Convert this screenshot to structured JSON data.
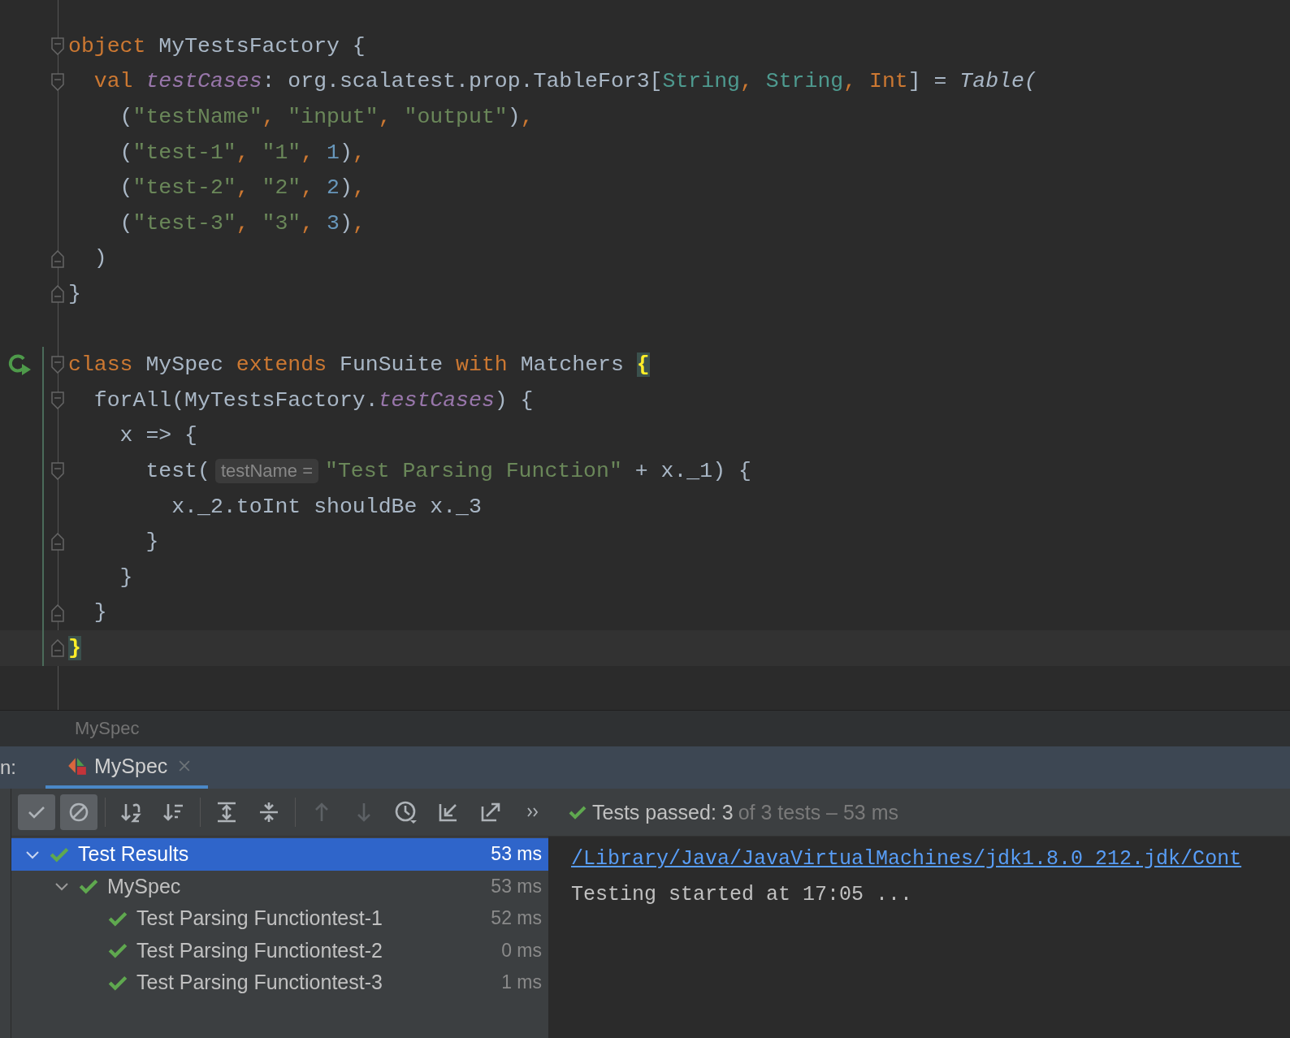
{
  "editor": {
    "lines": [
      {
        "kind": "code",
        "fold_start": true,
        "tokens": [
          {
            "kind": "kw",
            "text": "object"
          },
          {
            "kind": "plain",
            "text": " MyTestsFactory {"
          }
        ]
      },
      {
        "kind": "code",
        "fold_start": true,
        "tokens": [
          {
            "kind": "kw",
            "text": "  val "
          },
          {
            "kind": "field",
            "text": "testCases"
          },
          {
            "kind": "plain",
            "text": ": org.scalatest.prop.TableFor3["
          },
          {
            "kind": "type",
            "text": "String"
          },
          {
            "kind": "kw",
            "text": ", "
          },
          {
            "kind": "type",
            "text": "String"
          },
          {
            "kind": "kw",
            "text": ", "
          },
          {
            "kind": "kw",
            "text": "Int"
          },
          {
            "kind": "plain",
            "text": "] = "
          },
          {
            "kind": "italic",
            "text": "Table("
          }
        ]
      },
      {
        "kind": "code",
        "tokens": [
          {
            "kind": "plain",
            "text": "    ("
          },
          {
            "kind": "str",
            "text": "\"testName\""
          },
          {
            "kind": "kw",
            "text": ", "
          },
          {
            "kind": "str",
            "text": "\"input\""
          },
          {
            "kind": "kw",
            "text": ", "
          },
          {
            "kind": "str",
            "text": "\"output\""
          },
          {
            "kind": "plain",
            "text": ")"
          },
          {
            "kind": "kw",
            "text": ","
          }
        ]
      },
      {
        "kind": "code",
        "tokens": [
          {
            "kind": "plain",
            "text": "    ("
          },
          {
            "kind": "str",
            "text": "\"test-1\""
          },
          {
            "kind": "kw",
            "text": ", "
          },
          {
            "kind": "str",
            "text": "\"1\""
          },
          {
            "kind": "kw",
            "text": ", "
          },
          {
            "kind": "num",
            "text": "1"
          },
          {
            "kind": "plain",
            "text": ")"
          },
          {
            "kind": "kw",
            "text": ","
          }
        ]
      },
      {
        "kind": "code",
        "tokens": [
          {
            "kind": "plain",
            "text": "    ("
          },
          {
            "kind": "str",
            "text": "\"test-2\""
          },
          {
            "kind": "kw",
            "text": ", "
          },
          {
            "kind": "str",
            "text": "\"2\""
          },
          {
            "kind": "kw",
            "text": ", "
          },
          {
            "kind": "num",
            "text": "2"
          },
          {
            "kind": "plain",
            "text": ")"
          },
          {
            "kind": "kw",
            "text": ","
          }
        ]
      },
      {
        "kind": "code",
        "tokens": [
          {
            "kind": "plain",
            "text": "    ("
          },
          {
            "kind": "str",
            "text": "\"test-3\""
          },
          {
            "kind": "kw",
            "text": ", "
          },
          {
            "kind": "str",
            "text": "\"3\""
          },
          {
            "kind": "kw",
            "text": ", "
          },
          {
            "kind": "num",
            "text": "3"
          },
          {
            "kind": "plain",
            "text": ")"
          },
          {
            "kind": "kw",
            "text": ","
          }
        ]
      },
      {
        "kind": "code",
        "fold_end": true,
        "tokens": [
          {
            "kind": "plain",
            "text": "  )"
          }
        ]
      },
      {
        "kind": "code",
        "fold_end": true,
        "tokens": [
          {
            "kind": "plain",
            "text": "}"
          }
        ]
      },
      {
        "kind": "blank"
      },
      {
        "kind": "code",
        "fold_start": true,
        "run": true,
        "changed": true,
        "tokens": [
          {
            "kind": "kw",
            "text": "class"
          },
          {
            "kind": "plain",
            "text": " MySpec "
          },
          {
            "kind": "kw",
            "text": "extends"
          },
          {
            "kind": "plain",
            "text": " FunSuite "
          },
          {
            "kind": "kw",
            "text": "with"
          },
          {
            "kind": "plain",
            "text": " Matchers "
          },
          {
            "kind": "brace",
            "text": "{"
          }
        ]
      },
      {
        "kind": "code",
        "fold_start": true,
        "changed": true,
        "tokens": [
          {
            "kind": "plain",
            "text": "  forAll(MyTestsFactory."
          },
          {
            "kind": "field",
            "text": "testCases"
          },
          {
            "kind": "plain",
            "text": ") {"
          }
        ]
      },
      {
        "kind": "code",
        "changed": true,
        "tokens": [
          {
            "kind": "plain",
            "text": "    x => {"
          }
        ]
      },
      {
        "kind": "code",
        "fold_start": true,
        "changed": true,
        "tokens": [
          {
            "kind": "plain",
            "text": "      test("
          },
          {
            "kind": "hint",
            "text": "testName ="
          },
          {
            "kind": "str",
            "text": "\"Test Parsing Function\""
          },
          {
            "kind": "plain",
            "text": " + x._1) {"
          }
        ]
      },
      {
        "kind": "code",
        "changed": true,
        "tokens": [
          {
            "kind": "plain",
            "text": "        x._2.toInt shouldBe x._3"
          }
        ]
      },
      {
        "kind": "code",
        "fold_end": true,
        "changed": true,
        "tokens": [
          {
            "kind": "plain",
            "text": "      }"
          }
        ]
      },
      {
        "kind": "code",
        "changed": true,
        "tokens": [
          {
            "kind": "plain",
            "text": "    }"
          }
        ]
      },
      {
        "kind": "code",
        "fold_end": true,
        "changed": true,
        "tokens": [
          {
            "kind": "plain",
            "text": "  }"
          }
        ]
      },
      {
        "kind": "code",
        "fold_end": true,
        "changed": true,
        "current": true,
        "tokens": [
          {
            "kind": "brace",
            "text": "}"
          }
        ]
      }
    ]
  },
  "breadcrumb": "MySpec",
  "run_panel": {
    "label": "n:",
    "tabs": [
      {
        "label": "MySpec",
        "selected": true,
        "closable": true
      }
    ],
    "toolbar": [
      {
        "kind": "check",
        "on": true
      },
      {
        "kind": "ban",
        "on": true
      },
      {
        "kind": "sep"
      },
      {
        "kind": "sort-alpha"
      },
      {
        "kind": "sort-duration"
      },
      {
        "kind": "sep"
      },
      {
        "kind": "expand"
      },
      {
        "kind": "collapse"
      },
      {
        "kind": "sep"
      },
      {
        "kind": "up",
        "disabled": true
      },
      {
        "kind": "down",
        "disabled": true
      },
      {
        "kind": "history"
      },
      {
        "kind": "import"
      },
      {
        "kind": "export"
      },
      {
        "kind": "more"
      }
    ],
    "status": {
      "main": "Tests passed: 3",
      "rest": "of 3 tests – 53 ms"
    },
    "tree": [
      {
        "name": "Test Results",
        "time": "53 ms",
        "kind": "passed",
        "selected": true,
        "expanded": true,
        "children": [
          {
            "name": "MySpec",
            "time": "53 ms",
            "kind": "passed",
            "selected": false,
            "expanded": true,
            "children": [
              {
                "name": "Test Parsing Functiontest-1",
                "time": "52 ms",
                "kind": "passed",
                "selected": false
              },
              {
                "name": "Test Parsing Functiontest-2",
                "time": "0 ms",
                "kind": "passed",
                "selected": false
              },
              {
                "name": "Test Parsing Functiontest-3",
                "time": "1 ms",
                "kind": "passed",
                "selected": false
              }
            ]
          }
        ]
      }
    ],
    "console": [
      {
        "kind": "link",
        "text": "/Library/Java/JavaVirtualMachines/jdk1.8.0_212.jdk/Cont"
      },
      {
        "kind": "text",
        "text": "Testing started at 17:05 ..."
      }
    ]
  }
}
